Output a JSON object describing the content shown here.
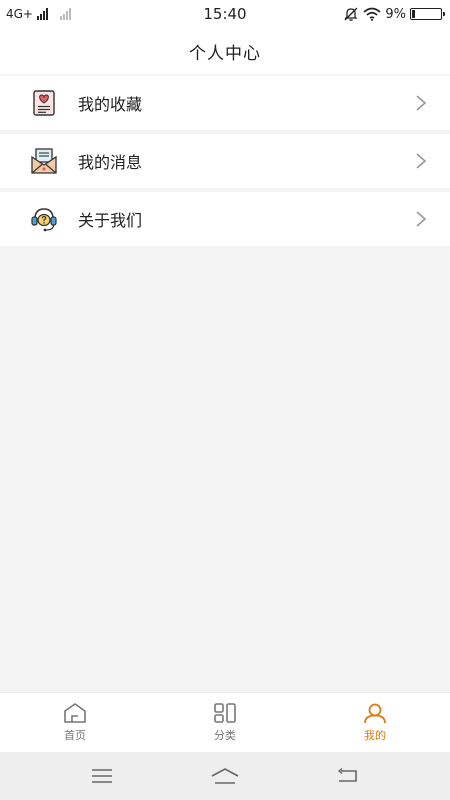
{
  "status_bar": {
    "network": "4G+",
    "time": "15:40",
    "battery": "9%",
    "battery_level": 0.09,
    "icons": [
      "signal-icon",
      "signal-secondary-icon",
      "bell-mute-icon",
      "wifi-icon",
      "battery-icon"
    ]
  },
  "header": {
    "title": "个人中心"
  },
  "menu": {
    "items": [
      {
        "label": "我的收藏",
        "icon": "favorites-heart-card-icon"
      },
      {
        "label": "我的消息",
        "icon": "mail-envelope-icon"
      },
      {
        "label": "关于我们",
        "icon": "headset-support-icon"
      }
    ]
  },
  "tabs": [
    {
      "label": "首页",
      "icon": "home-icon",
      "active": false
    },
    {
      "label": "分类",
      "icon": "category-icon",
      "active": false
    },
    {
      "label": "我的",
      "icon": "user-icon",
      "active": true
    }
  ],
  "colors": {
    "accent": "#e07a12",
    "tab_inactive": "#777777",
    "background": "#f4f4f5"
  }
}
